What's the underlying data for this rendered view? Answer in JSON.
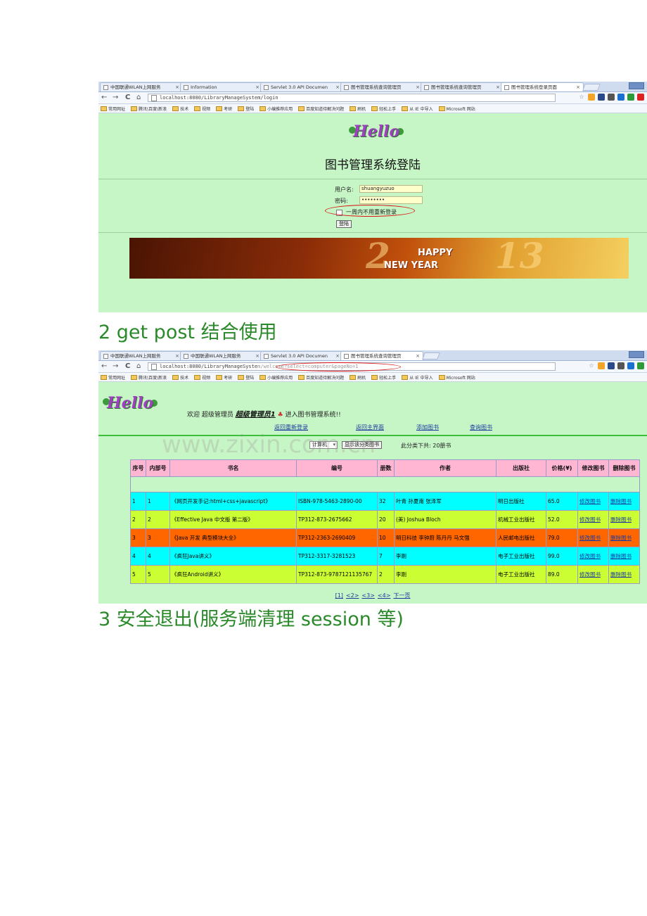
{
  "screenshot1": {
    "tabs": [
      "中国联通WLAN上网服务",
      "Information",
      "Servlet 3.0 API Documen",
      "图书管理系统查询管理页",
      "图书管理系统查询管理页",
      "图书管理系统登录页面"
    ],
    "url": "localhost:8080/LibraryManageSystem/login",
    "bookmarks": [
      "常用网址",
      "腾讯\\百度\\新浪",
      "技术",
      "视频",
      "考研",
      "登陆",
      "小编推荐应用",
      "百度知道待解决问题",
      "刷机",
      "轻松上手",
      "从 IE 中导入",
      "Microsoft 网站"
    ],
    "logo_text": "Hello",
    "title": "图书管理系统登陆",
    "username_label": "用户名:",
    "username_value": "shuangyuzuo",
    "password_label": "密码:",
    "password_value": "••••••••",
    "remember_label": "一周内不用重新登录",
    "login_button": "登陆",
    "banner": {
      "line1": "HAPPY",
      "line2": "NEW YEAR",
      "year_a": "2",
      "year_b": "13"
    }
  },
  "heading2": "2 get post  结合使用",
  "screenshot2": {
    "tabs": [
      "中国联通WLAN上网服务",
      "中国联通WLAN上网服务",
      "Servlet 3.0 API Documen",
      "图书管理系统查询管理页"
    ],
    "url_prefix": "localhost:8080/LibraryManageSyste",
    "url_highlight": "m/welcome?select=computer&pageNo=1",
    "bookmarks": [
      "常用网址",
      "腾讯\\百度\\新浪",
      "技术",
      "视频",
      "考研",
      "登陆",
      "小编推荐应用",
      "百度知道待解决问题",
      "刷机",
      "轻松上手",
      "从 IE 中导入",
      "Microsoft 网站"
    ],
    "logo_text": "Hello",
    "welcome_prefix": "欢迎 超级管理员",
    "admin_name": "超级管理员1",
    "welcome_suffix": "进入图书管理系统!!",
    "nav": [
      "返回重新登录",
      "返回主界面",
      "添加图书",
      "查询图书"
    ],
    "category_select": "计算机",
    "show_button": "显示该分类图书",
    "count_text": "此分类下共: 20册书",
    "watermark": "www.zixin.com.cn",
    "columns": [
      "序号",
      "内部号",
      "书名",
      "编号",
      "册数",
      "作者",
      "出版社",
      "价格(¥)",
      "修改图书",
      "删除图书"
    ],
    "rows": [
      {
        "seq": "1",
        "inner": "1",
        "name": "《网页开发手记:html+css+javascript》",
        "isbn": "ISBN-978-5463-2890-00",
        "qty": "32",
        "author": "叶青 孙夏南 张泽军",
        "publisher": "明日出版社",
        "price": "65.0",
        "edit": "修改图书",
        "del": "删除图书",
        "color": "#00ffff"
      },
      {
        "seq": "2",
        "inner": "2",
        "name": "《Effective Java 中文版 第二版》",
        "isbn": "TP312-873-2675662",
        "qty": "20",
        "author": "(美) Joshua Bloch",
        "publisher": "机械工业出版社",
        "price": "52.0",
        "edit": "修改图书",
        "del": "删除图书",
        "color": "#ccff33"
      },
      {
        "seq": "3",
        "inner": "3",
        "name": "《Java 开发 典型模块大全》",
        "isbn": "TP312-2363-2690409",
        "qty": "10",
        "author": "明日科技 李钟蔚 陈丹丹 马文强",
        "publisher": "人民邮电出版社",
        "price": "79.0",
        "edit": "修改图书",
        "del": "删除图书",
        "color": "#ff6600"
      },
      {
        "seq": "4",
        "inner": "4",
        "name": "《疯狂Java讲义》",
        "isbn": "TP312-3317-3281523",
        "qty": "7",
        "author": "李刚",
        "publisher": "电子工业出版社",
        "price": "99.0",
        "edit": "修改图书",
        "del": "删除图书",
        "color": "#00ffff"
      },
      {
        "seq": "5",
        "inner": "5",
        "name": "《疯狂Android讲义》",
        "isbn": "TP312-873-9787121135767",
        "qty": "2",
        "author": "李刚",
        "publisher": "电子工业出版社",
        "price": "89.0",
        "edit": "修改图书",
        "del": "删除图书",
        "color": "#ccff33"
      }
    ],
    "pager": [
      "[1]",
      "<2>",
      "<3>",
      "<4>",
      "下一页"
    ]
  },
  "heading3": "3  安全退出(服务端清理 session 等)"
}
